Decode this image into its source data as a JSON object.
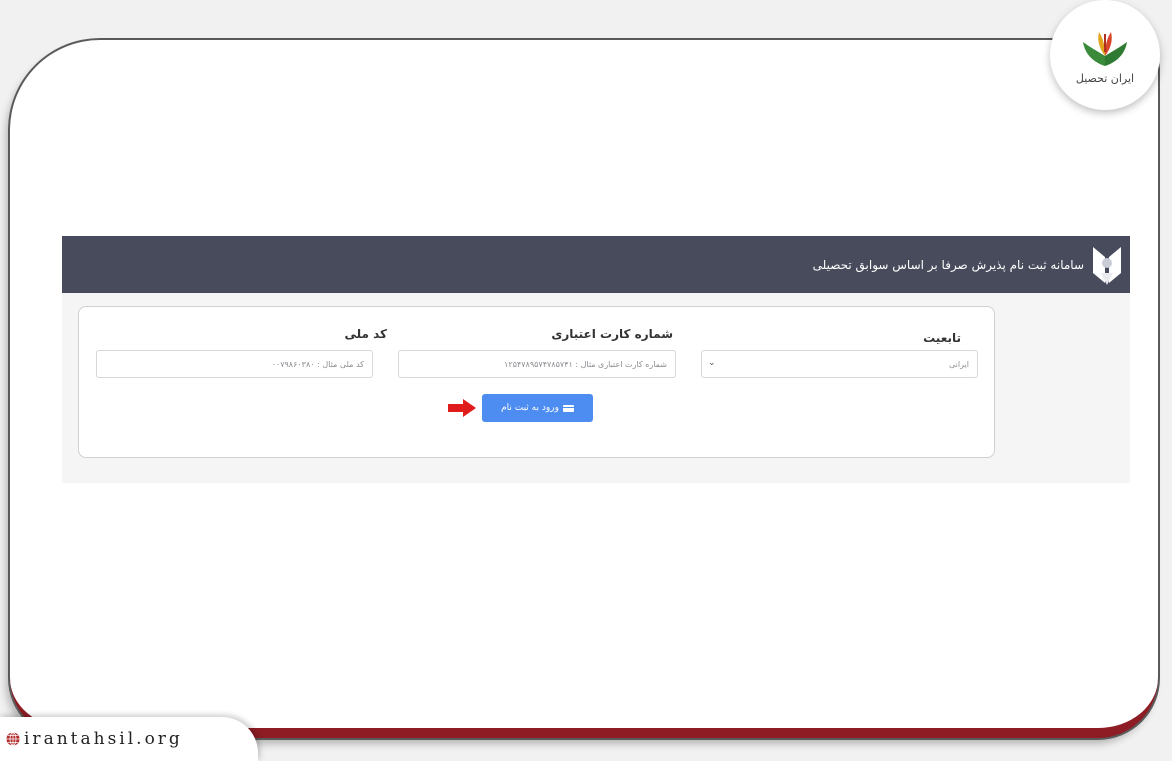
{
  "brand": {
    "name": "ایران تحصیل"
  },
  "header": {
    "title": "سامانه ثبت نام پذیرش صرفا بر اساس سوابق تحصیلی"
  },
  "form": {
    "nationality": {
      "label": "تابعیت",
      "value": "ایرانی"
    },
    "card_number": {
      "label": "شماره کارت اعتباری",
      "placeholder": "شماره کارت اعتباری مثال : ۱۲۵۴۷۸۹۵۷۴۷۸۵۷۴۱"
    },
    "national_code": {
      "label": "کد ملی",
      "placeholder": "کد ملی مثال : ۰۰۷۹۸۶۰۳۸۰"
    },
    "submit_label": "ورود به ثبت نام"
  },
  "watermark": {
    "url": "irantahsil.org"
  },
  "colors": {
    "header_bg": "#474b5b",
    "button": "#4d8cf0",
    "arrow": "#e01b1b",
    "bottom_bar": "#8d1c24"
  },
  "icons": [
    "university-logo-icon",
    "credit-card-icon",
    "chevron-down-icon",
    "right-arrow-icon",
    "globe-icon",
    "brand-logo-icon"
  ]
}
